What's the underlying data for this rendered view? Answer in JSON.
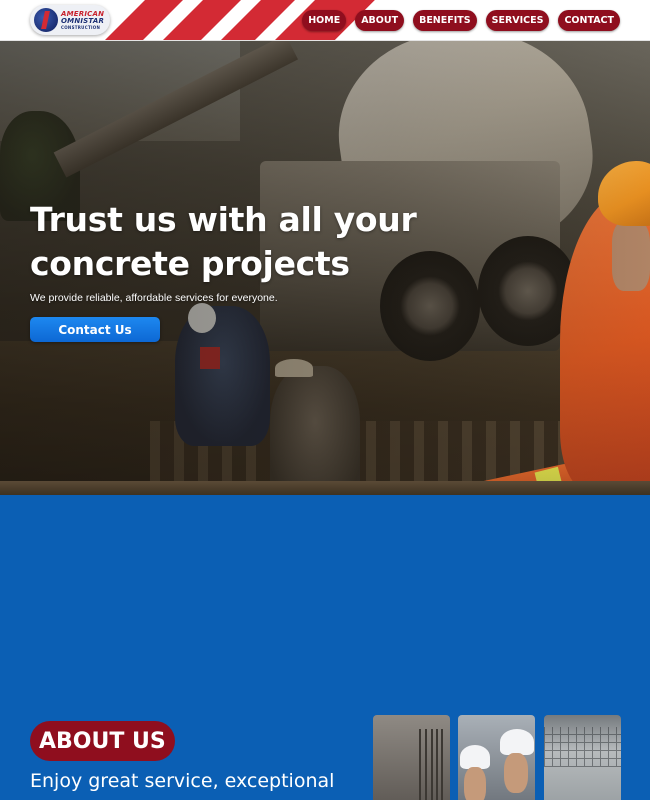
{
  "header": {
    "logo": {
      "line1": "AMERICAN",
      "line2": "OMNISTAR",
      "line3": "CONSTRUCTION"
    },
    "nav": [
      {
        "label": "HOME"
      },
      {
        "label": "ABOUT"
      },
      {
        "label": "BENEFITS"
      },
      {
        "label": "SERVICES"
      },
      {
        "label": "CONTACT"
      }
    ]
  },
  "hero": {
    "title_line1": "Trust us with all your",
    "title_line2": "concrete projects",
    "subtitle": "We provide reliable, affordable services for everyone.",
    "cta_label": "Contact Us"
  },
  "about": {
    "badge": "ABOUT US",
    "text": "Enjoy great service, exceptional"
  },
  "colors": {
    "brand_red": "#8f0e1e",
    "stripe_red": "#d32a34",
    "cta_blue": "#0d68d4",
    "section_blue": "#0b5fb4",
    "logo_navy": "#1c2f74"
  },
  "icons": [
    "logo-mark-icon"
  ]
}
